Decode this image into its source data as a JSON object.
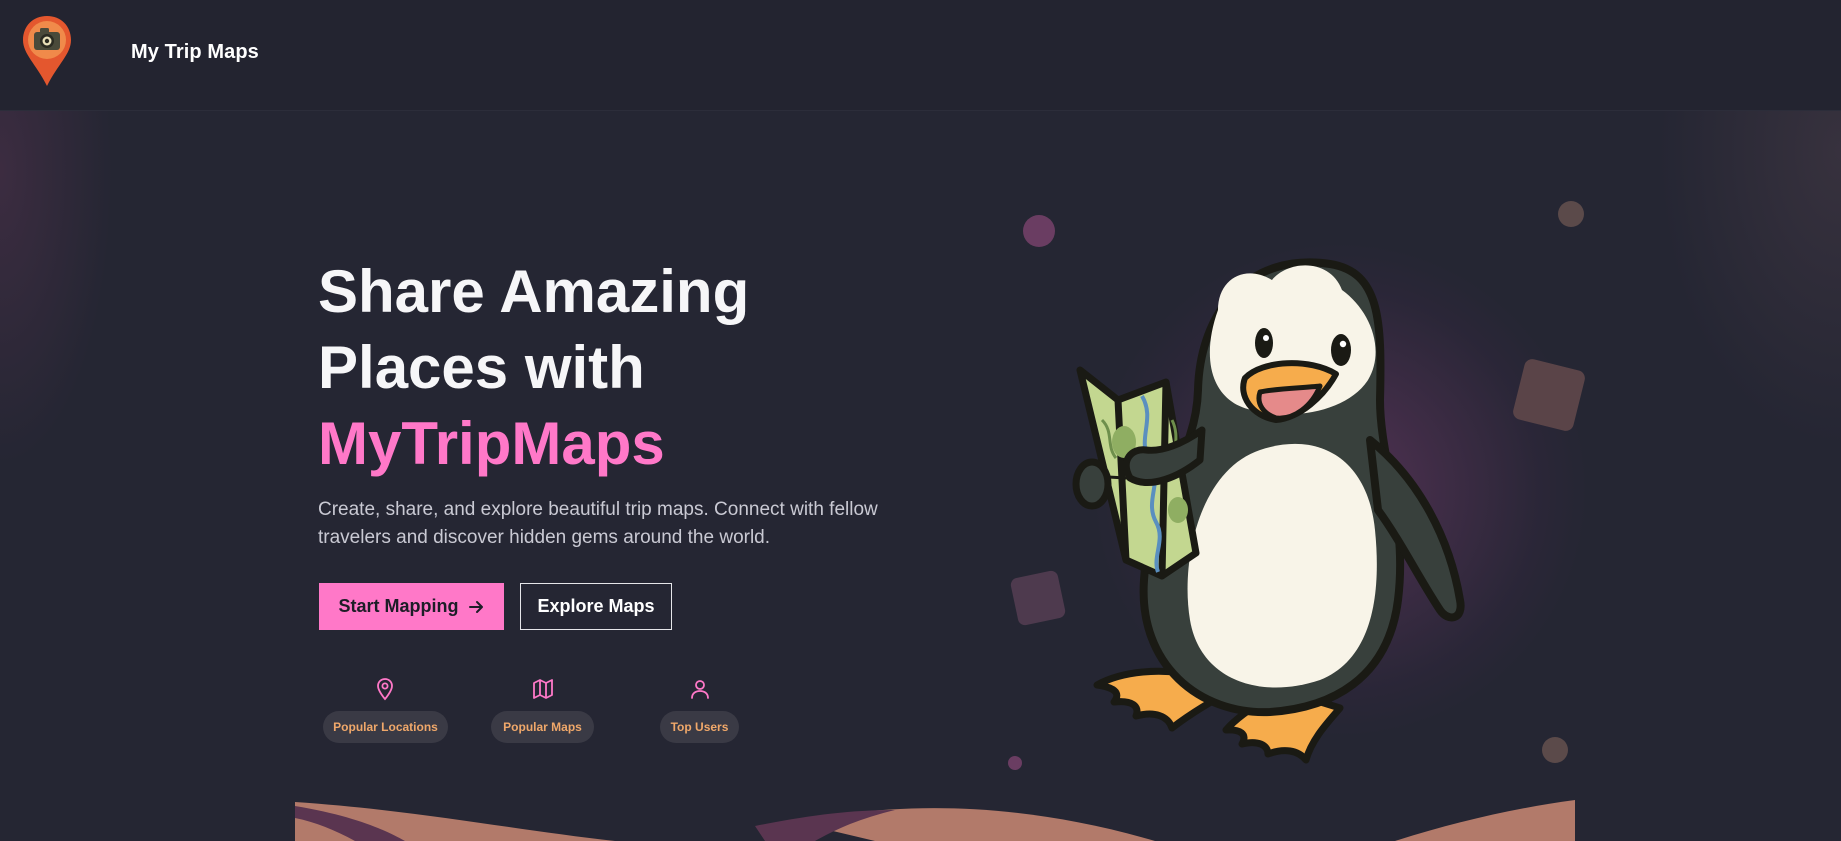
{
  "nav": {
    "brand": "My Trip Maps",
    "logo_icon": "camera-map-pin-icon"
  },
  "hero": {
    "title_line1": "Share Amazing",
    "title_line2": "Places with",
    "title_highlight": "MyTripMaps",
    "subtitle": "Create, share, and explore beautiful trip maps. Connect with fellow travelers and discover hidden gems around the world.",
    "primary_button": "Start Mapping",
    "secondary_button": "Explore Maps",
    "illustration": "penguin-holding-map-illustration"
  },
  "features": [
    {
      "label": "Popular Locations",
      "icon": "map-pin-icon"
    },
    {
      "label": "Popular Maps",
      "icon": "map-icon"
    },
    {
      "label": "Top Users",
      "icon": "user-icon"
    }
  ],
  "colors": {
    "background": "#252633",
    "accent_pink": "#ff78c8",
    "pill_text": "#f0a86a",
    "pill_bg": "#3a3a45"
  }
}
